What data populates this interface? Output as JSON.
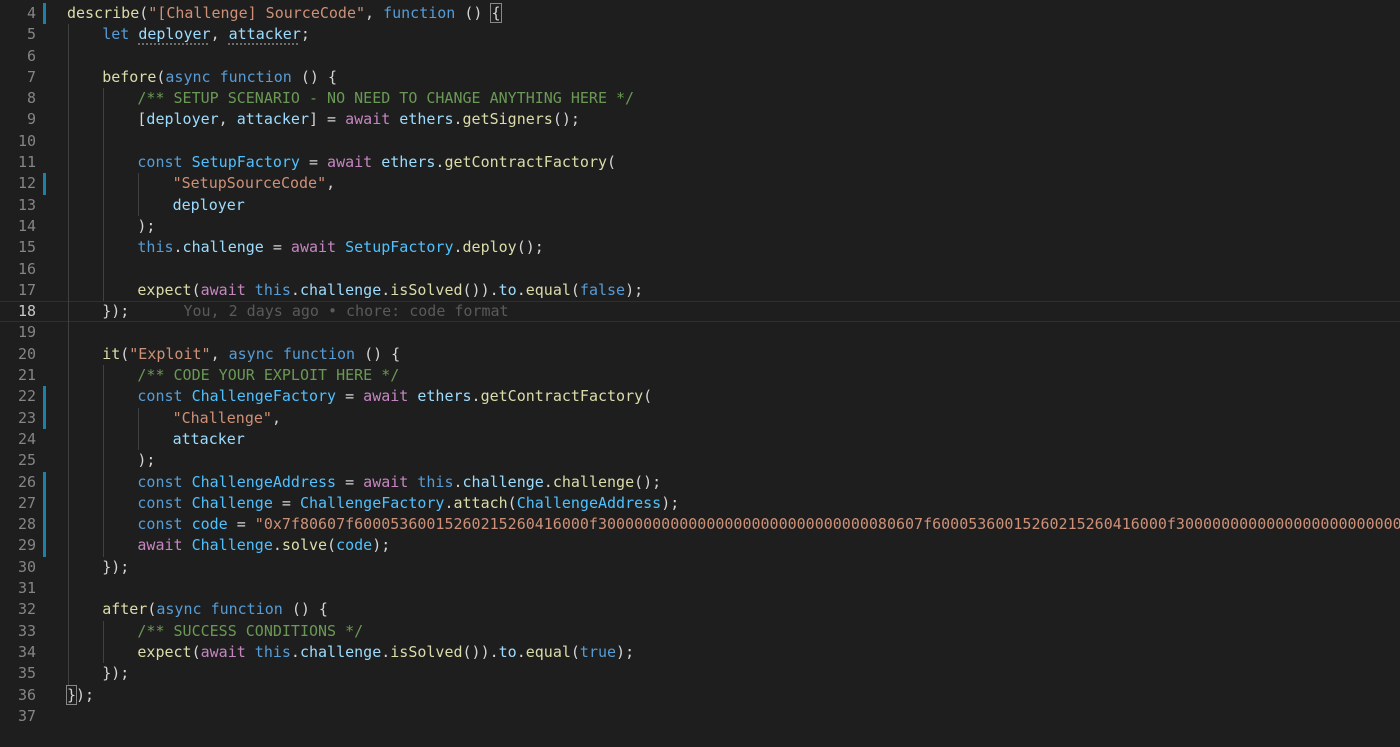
{
  "editor": {
    "language": "javascript",
    "cursor_line": 18,
    "lines": [
      {
        "n": "4",
        "mod": true,
        "indent": 0,
        "tokens": [
          [
            "f",
            "describe"
          ],
          [
            "p",
            "("
          ],
          [
            "s",
            "\"[Challenge] SourceCode\""
          ],
          [
            "p",
            ", "
          ],
          [
            "k",
            "function"
          ],
          [
            "p",
            " () "
          ],
          [
            "bracket",
            "{"
          ]
        ]
      },
      {
        "n": "5",
        "mod": false,
        "indent": 1,
        "tokens": [
          [
            "k",
            "let"
          ],
          [
            "p",
            " "
          ],
          [
            "vd",
            "deployer"
          ],
          [
            "p",
            ", "
          ],
          [
            "vd",
            "attacker"
          ],
          [
            "p",
            ";"
          ]
        ]
      },
      {
        "n": "6",
        "mod": false,
        "indent": 1,
        "tokens": []
      },
      {
        "n": "7",
        "mod": false,
        "indent": 1,
        "tokens": [
          [
            "f",
            "before"
          ],
          [
            "p",
            "("
          ],
          [
            "k",
            "async"
          ],
          [
            "p",
            " "
          ],
          [
            "k",
            "function"
          ],
          [
            "p",
            " () {"
          ]
        ]
      },
      {
        "n": "8",
        "mod": false,
        "indent": 2,
        "tokens": [
          [
            "cm",
            "/** SETUP SCENARIO - NO NEED TO CHANGE ANYTHING HERE */"
          ]
        ]
      },
      {
        "n": "9",
        "mod": false,
        "indent": 2,
        "tokens": [
          [
            "p",
            "["
          ],
          [
            "v",
            "deployer"
          ],
          [
            "p",
            ", "
          ],
          [
            "v",
            "attacker"
          ],
          [
            "p",
            "] = "
          ],
          [
            "c",
            "await"
          ],
          [
            "p",
            " "
          ],
          [
            "v",
            "ethers"
          ],
          [
            "p",
            "."
          ],
          [
            "f",
            "getSigners"
          ],
          [
            "p",
            "();"
          ]
        ]
      },
      {
        "n": "10",
        "mod": false,
        "indent": 2,
        "tokens": []
      },
      {
        "n": "11",
        "mod": false,
        "indent": 2,
        "tokens": [
          [
            "k",
            "const"
          ],
          [
            "p",
            " "
          ],
          [
            "t",
            "SetupFactory"
          ],
          [
            "p",
            " = "
          ],
          [
            "c",
            "await"
          ],
          [
            "p",
            " "
          ],
          [
            "v",
            "ethers"
          ],
          [
            "p",
            "."
          ],
          [
            "f",
            "getContractFactory"
          ],
          [
            "p",
            "("
          ]
        ]
      },
      {
        "n": "12",
        "mod": true,
        "indent": 3,
        "tokens": [
          [
            "s",
            "\"SetupSourceCode\""
          ],
          [
            "p",
            ","
          ]
        ]
      },
      {
        "n": "13",
        "mod": false,
        "indent": 3,
        "tokens": [
          [
            "v",
            "deployer"
          ]
        ]
      },
      {
        "n": "14",
        "mod": false,
        "indent": 2,
        "tokens": [
          [
            "p",
            ");"
          ]
        ]
      },
      {
        "n": "15",
        "mod": false,
        "indent": 2,
        "tokens": [
          [
            "k",
            "this"
          ],
          [
            "p",
            "."
          ],
          [
            "v",
            "challenge"
          ],
          [
            "p",
            " = "
          ],
          [
            "c",
            "await"
          ],
          [
            "p",
            " "
          ],
          [
            "t",
            "SetupFactory"
          ],
          [
            "p",
            "."
          ],
          [
            "f",
            "deploy"
          ],
          [
            "p",
            "();"
          ]
        ]
      },
      {
        "n": "16",
        "mod": false,
        "indent": 2,
        "tokens": []
      },
      {
        "n": "17",
        "mod": false,
        "indent": 2,
        "tokens": [
          [
            "f",
            "expect"
          ],
          [
            "p",
            "("
          ],
          [
            "c",
            "await"
          ],
          [
            "p",
            " "
          ],
          [
            "k",
            "this"
          ],
          [
            "p",
            "."
          ],
          [
            "v",
            "challenge"
          ],
          [
            "p",
            "."
          ],
          [
            "f",
            "isSolved"
          ],
          [
            "p",
            "())."
          ],
          [
            "v",
            "to"
          ],
          [
            "p",
            "."
          ],
          [
            "f",
            "equal"
          ],
          [
            "p",
            "("
          ],
          [
            "k",
            "false"
          ],
          [
            "p",
            ");"
          ]
        ]
      },
      {
        "n": "18",
        "mod": false,
        "indent": 1,
        "tokens": [
          [
            "p",
            "});"
          ],
          [
            "blame",
            "      You, 2 days ago • chore: code format"
          ]
        ]
      },
      {
        "n": "19",
        "mod": false,
        "indent": 1,
        "tokens": []
      },
      {
        "n": "20",
        "mod": false,
        "indent": 1,
        "tokens": [
          [
            "f",
            "it"
          ],
          [
            "p",
            "("
          ],
          [
            "s",
            "\"Exploit\""
          ],
          [
            "p",
            ", "
          ],
          [
            "k",
            "async"
          ],
          [
            "p",
            " "
          ],
          [
            "k",
            "function"
          ],
          [
            "p",
            " () {"
          ]
        ]
      },
      {
        "n": "21",
        "mod": false,
        "indent": 2,
        "tokens": [
          [
            "cm",
            "/** CODE YOUR EXPLOIT HERE */"
          ]
        ]
      },
      {
        "n": "22",
        "mod": true,
        "indent": 2,
        "tokens": [
          [
            "k",
            "const"
          ],
          [
            "p",
            " "
          ],
          [
            "t",
            "ChallengeFactory"
          ],
          [
            "p",
            " = "
          ],
          [
            "c",
            "await"
          ],
          [
            "p",
            " "
          ],
          [
            "v",
            "ethers"
          ],
          [
            "p",
            "."
          ],
          [
            "f",
            "getContractFactory"
          ],
          [
            "p",
            "("
          ]
        ]
      },
      {
        "n": "23",
        "mod": true,
        "indent": 3,
        "tokens": [
          [
            "s",
            "\"Challenge\""
          ],
          [
            "p",
            ","
          ]
        ]
      },
      {
        "n": "24",
        "mod": false,
        "indent": 3,
        "tokens": [
          [
            "v",
            "attacker"
          ]
        ]
      },
      {
        "n": "25",
        "mod": false,
        "indent": 2,
        "tokens": [
          [
            "p",
            ");"
          ]
        ]
      },
      {
        "n": "26",
        "mod": true,
        "indent": 2,
        "tokens": [
          [
            "k",
            "const"
          ],
          [
            "p",
            " "
          ],
          [
            "t",
            "ChallengeAddress"
          ],
          [
            "p",
            " = "
          ],
          [
            "c",
            "await"
          ],
          [
            "p",
            " "
          ],
          [
            "k",
            "this"
          ],
          [
            "p",
            "."
          ],
          [
            "v",
            "challenge"
          ],
          [
            "p",
            "."
          ],
          [
            "f",
            "challenge"
          ],
          [
            "p",
            "();"
          ]
        ]
      },
      {
        "n": "27",
        "mod": true,
        "indent": 2,
        "tokens": [
          [
            "k",
            "const"
          ],
          [
            "p",
            " "
          ],
          [
            "t",
            "Challenge"
          ],
          [
            "p",
            " = "
          ],
          [
            "t",
            "ChallengeFactory"
          ],
          [
            "p",
            "."
          ],
          [
            "f",
            "attach"
          ],
          [
            "p",
            "("
          ],
          [
            "t",
            "ChallengeAddress"
          ],
          [
            "p",
            ");"
          ]
        ]
      },
      {
        "n": "28",
        "mod": true,
        "indent": 2,
        "tokens": [
          [
            "k",
            "const"
          ],
          [
            "p",
            " "
          ],
          [
            "t",
            "code"
          ],
          [
            "p",
            " = "
          ],
          [
            "s",
            "\"0x7f80607f60005360015260215260416000f300000000000000000000000000000080607f60005360015260215260416000f300000000000000000000000000000\""
          ],
          [
            "p",
            ";"
          ]
        ]
      },
      {
        "n": "29",
        "mod": true,
        "indent": 2,
        "tokens": [
          [
            "c",
            "await"
          ],
          [
            "p",
            " "
          ],
          [
            "t",
            "Challenge"
          ],
          [
            "p",
            "."
          ],
          [
            "f",
            "solve"
          ],
          [
            "p",
            "("
          ],
          [
            "t",
            "code"
          ],
          [
            "p",
            ");"
          ]
        ]
      },
      {
        "n": "30",
        "mod": false,
        "indent": 1,
        "tokens": [
          [
            "p",
            "});"
          ]
        ]
      },
      {
        "n": "31",
        "mod": false,
        "indent": 1,
        "tokens": []
      },
      {
        "n": "32",
        "mod": false,
        "indent": 1,
        "tokens": [
          [
            "f",
            "after"
          ],
          [
            "p",
            "("
          ],
          [
            "k",
            "async"
          ],
          [
            "p",
            " "
          ],
          [
            "k",
            "function"
          ],
          [
            "p",
            " () {"
          ]
        ]
      },
      {
        "n": "33",
        "mod": false,
        "indent": 2,
        "tokens": [
          [
            "cm",
            "/** SUCCESS CONDITIONS */"
          ]
        ]
      },
      {
        "n": "34",
        "mod": false,
        "indent": 2,
        "tokens": [
          [
            "f",
            "expect"
          ],
          [
            "p",
            "("
          ],
          [
            "c",
            "await"
          ],
          [
            "p",
            " "
          ],
          [
            "k",
            "this"
          ],
          [
            "p",
            "."
          ],
          [
            "v",
            "challenge"
          ],
          [
            "p",
            "."
          ],
          [
            "f",
            "isSolved"
          ],
          [
            "p",
            "())."
          ],
          [
            "v",
            "to"
          ],
          [
            "p",
            "."
          ],
          [
            "f",
            "equal"
          ],
          [
            "p",
            "("
          ],
          [
            "k",
            "true"
          ],
          [
            "p",
            ");"
          ]
        ]
      },
      {
        "n": "35",
        "mod": false,
        "indent": 1,
        "tokens": [
          [
            "p",
            "});"
          ]
        ]
      },
      {
        "n": "36",
        "mod": false,
        "indent": 0,
        "tokens": [
          [
            "bracket",
            "}"
          ],
          [
            "p",
            ");"
          ]
        ]
      },
      {
        "n": "37",
        "mod": false,
        "indent": 0,
        "tokens": []
      }
    ]
  },
  "colors": {
    "background": "#1e1e1e",
    "line_number": "#858585",
    "modified_marker": "#1b81a8",
    "keyword": "#569cd6",
    "control": "#c586c0",
    "function": "#dcdcaa",
    "variable": "#9cdcfe",
    "string": "#ce9178",
    "type": "#4fc1ff",
    "comment": "#6a9955"
  }
}
